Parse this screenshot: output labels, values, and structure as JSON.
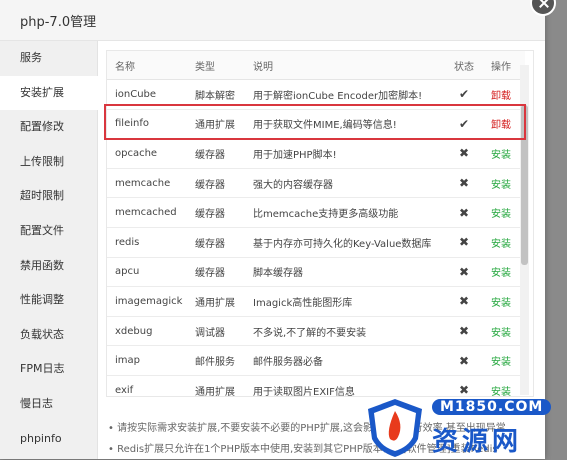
{
  "window": {
    "title": "php-7.0管理"
  },
  "sidebar": {
    "items": [
      {
        "label": "服务"
      },
      {
        "label": "安装扩展"
      },
      {
        "label": "配置修改"
      },
      {
        "label": "上传限制"
      },
      {
        "label": "超时限制"
      },
      {
        "label": "配置文件"
      },
      {
        "label": "禁用函数"
      },
      {
        "label": "性能调整"
      },
      {
        "label": "负载状态"
      },
      {
        "label": "FPM日志"
      },
      {
        "label": "慢日志"
      },
      {
        "label": "phpinfo"
      }
    ],
    "active_index": 1
  },
  "table": {
    "headers": {
      "name": "名称",
      "type": "类型",
      "desc": "说明",
      "status": "状态",
      "op": "操作"
    },
    "rows": [
      {
        "name": "ionCube",
        "type": "脚本解密",
        "desc": "用于解密ionCube Encoder加密脚本!",
        "installed": true,
        "op": "卸载"
      },
      {
        "name": "fileinfo",
        "type": "通用扩展",
        "desc": "用于获取文件MIME,编码等信息!",
        "installed": true,
        "op": "卸载"
      },
      {
        "name": "opcache",
        "type": "缓存器",
        "desc": "用于加速PHP脚本!",
        "installed": false,
        "op": "安装"
      },
      {
        "name": "memcache",
        "type": "缓存器",
        "desc": "强大的内容缓存器",
        "installed": false,
        "op": "安装"
      },
      {
        "name": "memcached",
        "type": "缓存器",
        "desc": "比memcache支持更多高级功能",
        "installed": false,
        "op": "安装"
      },
      {
        "name": "redis",
        "type": "缓存器",
        "desc": "基于内存亦可持久化的Key-Value数据库",
        "installed": false,
        "op": "安装"
      },
      {
        "name": "apcu",
        "type": "缓存器",
        "desc": "脚本缓存器",
        "installed": false,
        "op": "安装"
      },
      {
        "name": "imagemagick",
        "type": "通用扩展",
        "desc": "Imagick高性能图形库",
        "installed": false,
        "op": "安装"
      },
      {
        "name": "xdebug",
        "type": "调试器",
        "desc": "不多说,不了解的不要安装",
        "installed": false,
        "op": "安装"
      },
      {
        "name": "imap",
        "type": "邮件服务",
        "desc": "邮件服务器必备",
        "installed": false,
        "op": "安装"
      },
      {
        "name": "exif",
        "type": "通用扩展",
        "desc": "用于读取图片EXIF信息",
        "installed": false,
        "op": "安装"
      }
    ]
  },
  "notes": [
    "请按实际需求安装扩展,不要安装不必要的PHP扩展,这会影响PHP执行效率,甚至出现异常",
    "Redis扩展只允许在1个PHP版本中使用,安装到其它PHP版本请在[软件管理]重装Redis"
  ],
  "watermark": {
    "top": "M1850.COM",
    "main": "资源网"
  },
  "colors": {
    "uninstall": "#d31b1b",
    "install": "#20a53a",
    "highlight": "#d9363e",
    "watermark": "#1a58c8"
  }
}
